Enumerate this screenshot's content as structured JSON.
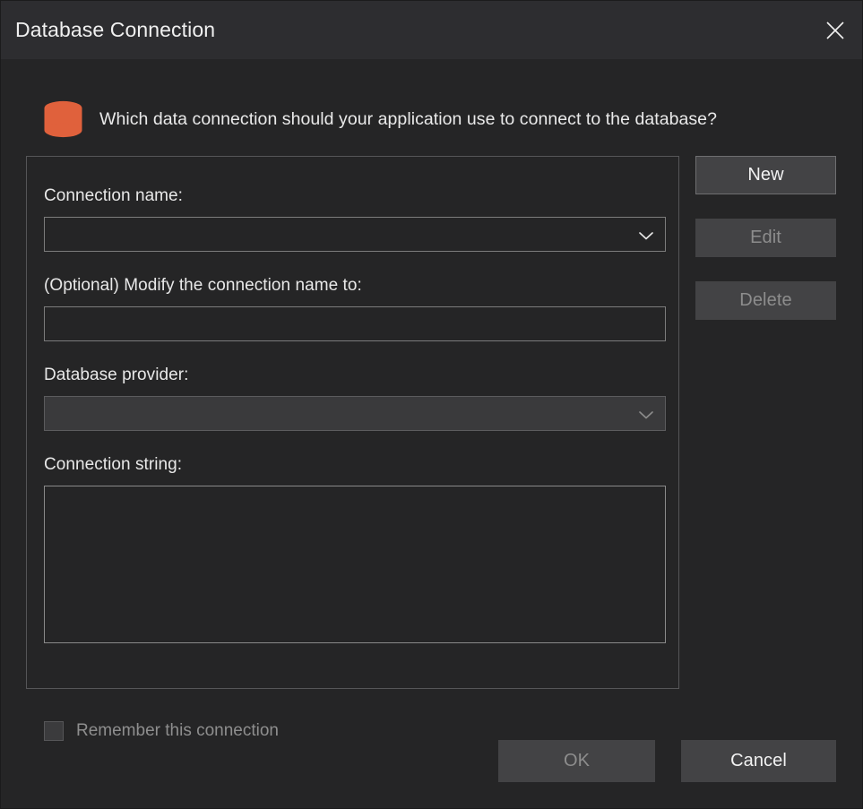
{
  "window": {
    "title": "Database Connection",
    "close_icon": "close-icon"
  },
  "prompt": {
    "icon": "database-icon",
    "text": "Which data connection should your application use to connect to the database?"
  },
  "form": {
    "connection_name": {
      "label": "Connection name:",
      "value": "",
      "placeholder": "",
      "dropdown_icon": "chevron-down-icon"
    },
    "modify_name": {
      "label": "(Optional) Modify the connection name to:",
      "value": "",
      "placeholder": ""
    },
    "database_provider": {
      "label": "Database provider:",
      "value": "",
      "placeholder": "",
      "dropdown_icon": "chevron-down-icon",
      "disabled": true
    },
    "connection_string": {
      "label": "Connection string:",
      "value": "",
      "placeholder": ""
    },
    "remember": {
      "label": "Remember this connection",
      "checked": false,
      "disabled": true
    }
  },
  "side_buttons": [
    {
      "label": "New",
      "disabled": false
    },
    {
      "label": "Edit",
      "disabled": true
    },
    {
      "label": "Delete",
      "disabled": true
    }
  ],
  "footer_buttons": [
    {
      "label": "OK",
      "disabled": true
    },
    {
      "label": "Cancel",
      "disabled": false
    }
  ],
  "colors": {
    "window_background": "#252526",
    "titlebar_background": "#2d2d30",
    "accent_icon": "#e0613c",
    "button_face": "#434345",
    "text_primary": "#eaeaea",
    "text_disabled": "#8d8d8d",
    "border": "#7c7c7c"
  }
}
